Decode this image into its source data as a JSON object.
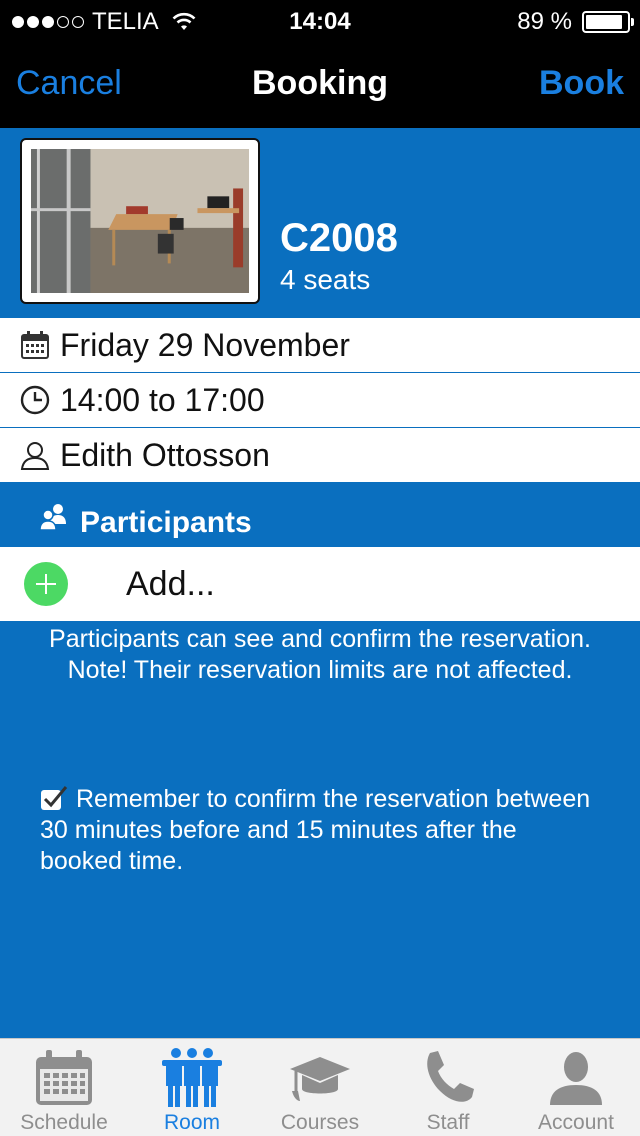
{
  "status_bar": {
    "carrier": "TELIA",
    "time": "14:04",
    "battery": "89 %",
    "battery_level": 0.89,
    "signal_strength": 3
  },
  "nav": {
    "cancel_label": "Cancel",
    "title": "Booking",
    "book_label": "Book",
    "accent": "#1a7fe0"
  },
  "room": {
    "name": "C2008",
    "seats": "4 seats"
  },
  "details": {
    "date": "Friday 29 November",
    "time": "14:00 to 17:00",
    "person": "Edith Ottosson"
  },
  "participants": {
    "heading": "Participants",
    "add_label": "Add...",
    "note": "Participants can see and confirm the reservation. Note! Their reservation limits are not affected."
  },
  "reminder": "Remember to confirm the reservation between 30 minutes before and 15 minutes after the booked time.",
  "colors": {
    "background": "#0a6fbf",
    "active_tab": "#1a7fe0",
    "add_button": "#4cd964"
  },
  "tabs": [
    {
      "label": "Schedule",
      "icon": "calendar-icon",
      "active": false
    },
    {
      "label": "Room",
      "icon": "room-people-icon",
      "active": true
    },
    {
      "label": "Courses",
      "icon": "graduation-cap-icon",
      "active": false
    },
    {
      "label": "Staff",
      "icon": "phone-icon",
      "active": false
    },
    {
      "label": "Account",
      "icon": "user-icon",
      "active": false
    }
  ]
}
